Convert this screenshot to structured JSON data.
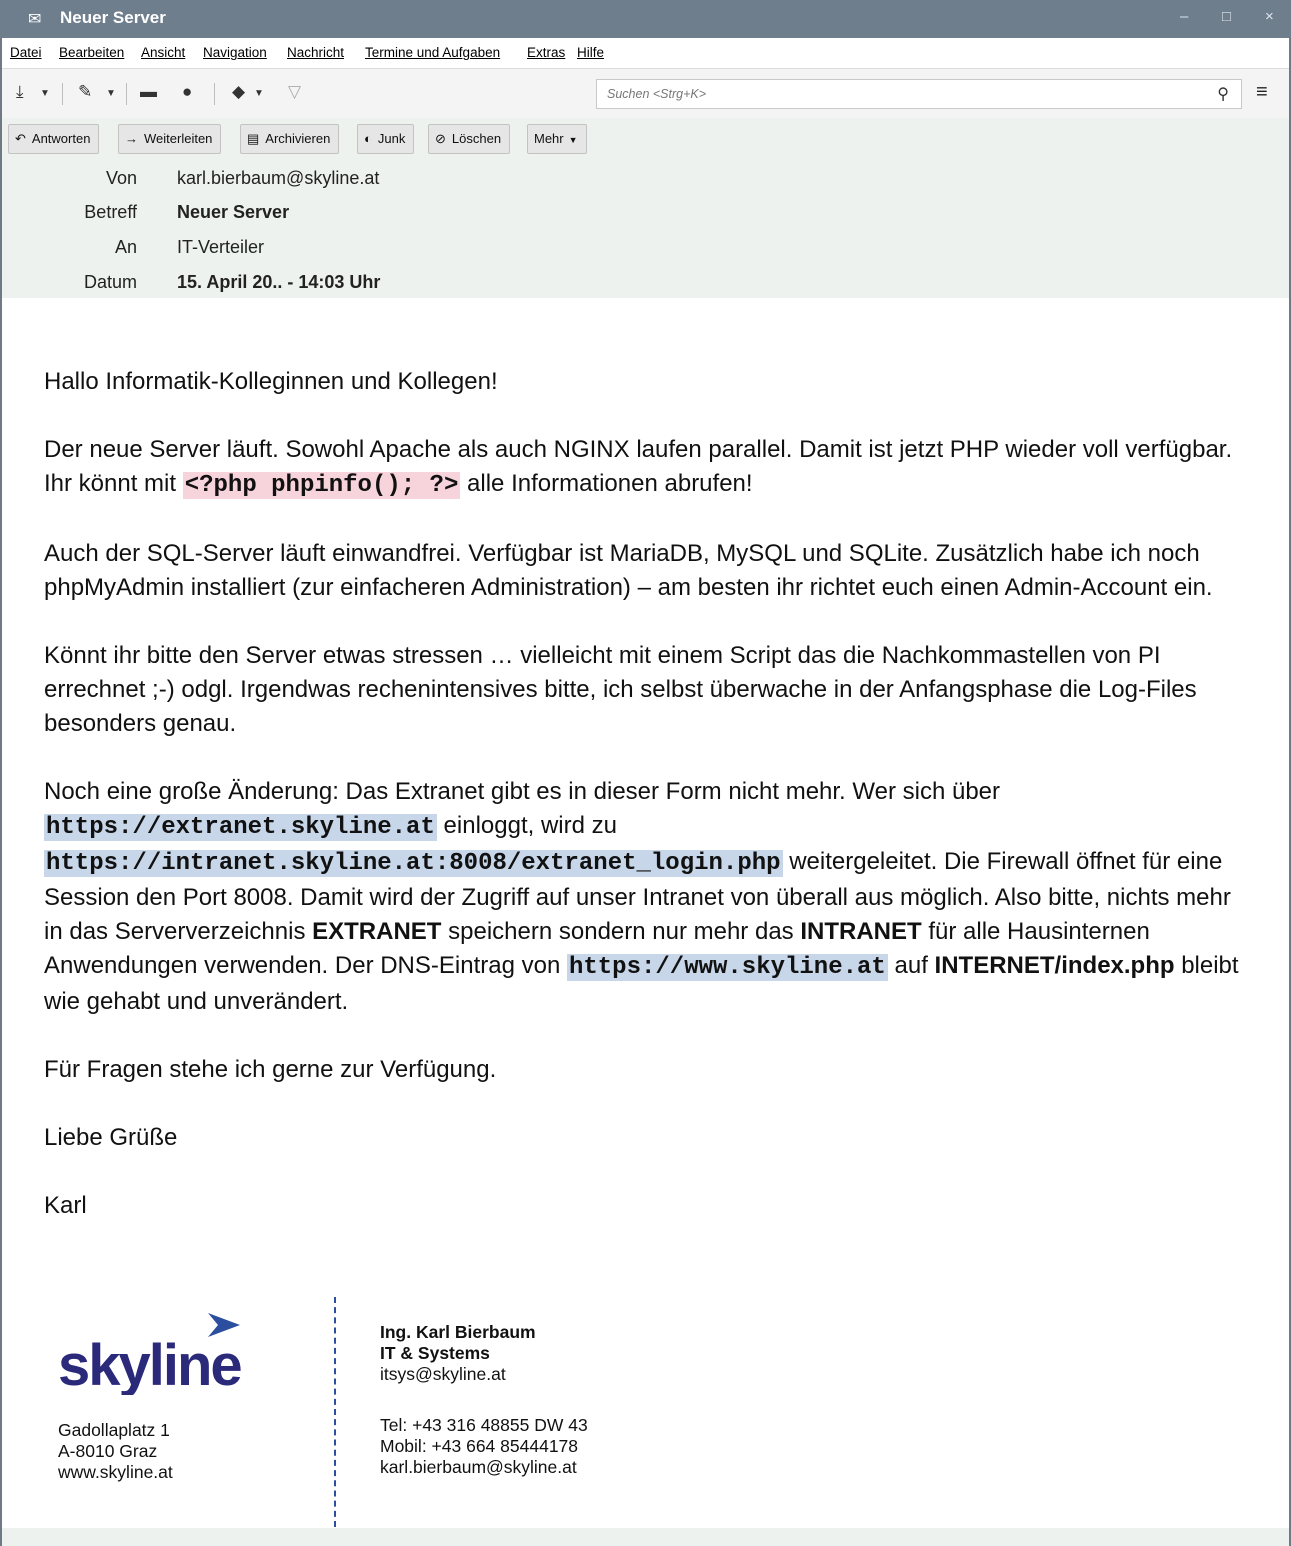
{
  "window": {
    "title": "Neuer Server",
    "controls": [
      "–",
      "□",
      "×"
    ]
  },
  "menubar": [
    "Datei",
    "Bearbeiten",
    "Ansicht",
    "Navigation",
    "Nachricht",
    "Termine und Aufgaben",
    "Extras",
    "Hilfe"
  ],
  "toolbar": {
    "icons": [
      "download-icon",
      "write-icon",
      "chat-icon",
      "address-book-icon",
      "tag-icon",
      "filter-icon",
      "hamburger-menu-icon"
    ],
    "search_placeholder": "Suchen <Strg+K>"
  },
  "actions": {
    "reply": "Antworten",
    "forward": "Weiterleiten",
    "archive": "Archivieren",
    "junk": "Junk",
    "delete": "Löschen",
    "more": "Mehr"
  },
  "headers": {
    "from_label": "Von",
    "from": "karl.bierbaum@skyline.at",
    "subject_label": "Betreff",
    "subject": "Neuer Server",
    "to_label": "An",
    "to": "IT-Verteiler",
    "date_label": "Datum",
    "date": "15. April 20.. - 14:03 Uhr"
  },
  "body": {
    "greeting": "Hallo Informatik-Kolleginnen und Kollegen!",
    "p1_a": "Der neue Server läuft. Sowohl Apache als auch NGINX laufen parallel. Damit ist jetzt PHP wieder voll verfügbar. Ihr könnt mit ",
    "p1_code": "<?php phpinfo(); ?>",
    "p1_b": " alle Informationen abrufen!",
    "p2": "Auch der SQL-Server läuft einwandfrei. Verfügbar ist MariaDB, MySQL und SQLite. Zusätzlich habe ich noch phpMyAdmin installiert (zur einfacheren Administration) – am besten ihr richtet euch einen Admin-Account ein.",
    "p3": "Könnt ihr bitte den Server etwas stressen … vielleicht mit einem Script das die Nachkommastellen von PI errechnet ;-) odgl. Irgendwas rechenintensives bitte, ich selbst überwache in der Anfangsphase die Log-Files besonders genau.",
    "p4_a": "Noch eine große Änderung: Das Extranet gibt es in dieser Form nicht mehr. Wer sich über ",
    "p4_url1": "https://extranet.skyline.at",
    "p4_b": " einloggt, wird zu ",
    "p4_url2": "https://intranet.skyline.at:8008/extranet_login.php",
    "p4_c": " weitergeleitet. Die Firewall öffnet für eine Session den Port 8008. Damit wird der Zugriff auf unser Intranet von überall aus möglich. Also bitte, nichts mehr in das Serververzeichnis ",
    "p4_extranet": "EXTRANET",
    "p4_d": " speichern sondern nur mehr das ",
    "p4_intranet": "INTRANET",
    "p4_e": " für alle Hausinternen Anwendungen verwenden. Der DNS-Eintrag von ",
    "p4_url3": "https://www.skyline.at",
    "p4_f": " auf ",
    "p4_internet": "INTERNET/index.php",
    "p4_g": " bleibt wie gehabt und unverändert.",
    "p5": "Für Fragen stehe ich gerne zur Verfügung.",
    "closing": "Liebe Grüße",
    "name": "Karl"
  },
  "signature": {
    "logo_text": "skyline",
    "address": [
      "Gadollaplatz 1",
      "A-8010 Graz",
      "www.skyline.at"
    ],
    "name": "Ing. Karl Bierbaum",
    "dept": "IT & Systems",
    "dept_email": "itsys@skyline.at",
    "tel": "Tel: +43 316 48855 DW 43",
    "mobile": "Mobil: +43 664 85444178",
    "email": "karl.bierbaum@skyline.at"
  },
  "colors": {
    "titlebar": "#6f7e8d",
    "header_bg": "#eef2ef",
    "logo_blue": "#2b2a7a",
    "logo_accent": "#2b4f9e",
    "code_pink": "#f7d3dc",
    "code_blue": "#c7d6e8"
  }
}
